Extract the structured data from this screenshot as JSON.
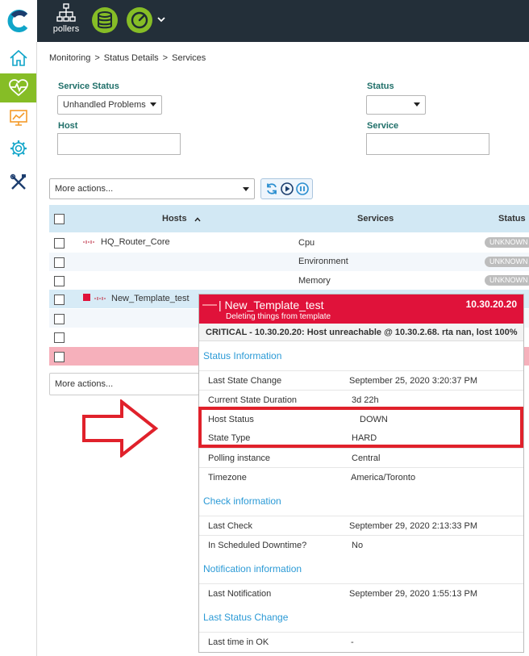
{
  "topbar": {
    "pollers_label": "pollers"
  },
  "breadcrumb": [
    "Monitoring",
    "Status Details",
    "Services"
  ],
  "filters": {
    "service_status_label": "Service Status",
    "service_status_value": "Unhandled Problems",
    "status_label": "Status",
    "status_value": "",
    "host_label": "Host",
    "host_value": "",
    "service_label": "Service",
    "service_value": ""
  },
  "actions": {
    "more_actions_top": "More actions...",
    "more_actions_bottom": "More actions..."
  },
  "table": {
    "headers": {
      "hosts": "Hosts",
      "services": "Services",
      "status": "Status"
    },
    "rows": [
      {
        "host": "HQ_Router_Core",
        "service": "Cpu",
        "status": "UNKNOWN"
      },
      {
        "host": "",
        "service": "Environment",
        "status": "UNKNOWN"
      },
      {
        "host": "",
        "service": "Memory",
        "status": "UNKNOWN"
      },
      {
        "host": "New_Template_test",
        "service": "",
        "status": ""
      }
    ]
  },
  "popup": {
    "title": "| New_Template_test",
    "subtitle": "Deleting things from template",
    "ip": "10.30.20.20",
    "summary": "CRITICAL - 10.30.20.20: Host unreachable @ 10.30.2.68. rta nan, lost 100%",
    "sections": {
      "status_info": "Status Information",
      "check_info": "Check information",
      "notification_info": "Notification information",
      "last_status_change": "Last Status Change"
    },
    "fields": {
      "last_state_change": {
        "k": "Last State Change",
        "v": "September 25, 2020 3:20:37 PM"
      },
      "current_state_duration": {
        "k": "Current State Duration",
        "v": "3d 22h"
      },
      "host_status": {
        "k": "Host Status",
        "v": "DOWN"
      },
      "state_type": {
        "k": "State Type",
        "v": "HARD"
      },
      "polling_instance": {
        "k": "Polling instance",
        "v": "Central"
      },
      "timezone": {
        "k": "Timezone",
        "v": "America/Toronto"
      },
      "last_check": {
        "k": "Last Check",
        "v": "September 29, 2020 2:13:33 PM"
      },
      "scheduled_downtime": {
        "k": "In Scheduled Downtime?",
        "v": "No"
      },
      "last_notification": {
        "k": "Last Notification",
        "v": "September 29, 2020 1:55:13 PM"
      },
      "last_time_ok": {
        "k": "Last time in OK",
        "v": "-"
      }
    }
  },
  "colors": {
    "accent_green": "#86bd26",
    "critical_red": "#e0123a",
    "link_blue": "#2b9ad6",
    "header_dark": "#232f39"
  }
}
